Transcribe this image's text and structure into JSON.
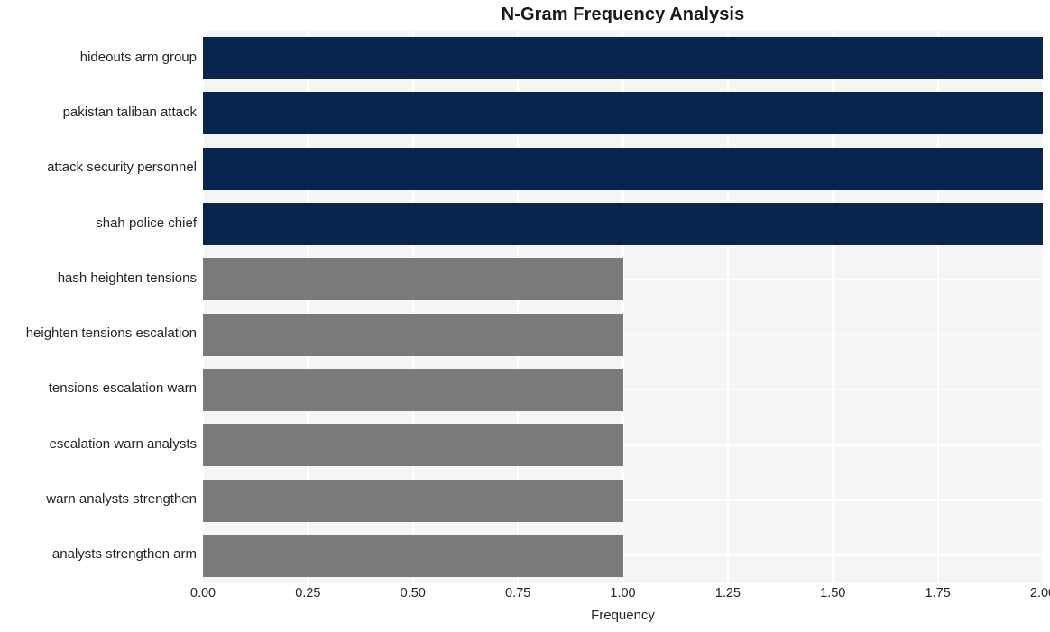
{
  "chart_data": {
    "type": "bar",
    "orientation": "horizontal",
    "title": "N-Gram Frequency Analysis",
    "xlabel": "Frequency",
    "ylabel": "",
    "categories": [
      "hideouts arm group",
      "pakistan taliban attack",
      "attack security personnel",
      "shah police chief",
      "hash heighten tensions",
      "heighten tensions escalation",
      "tensions escalation warn",
      "escalation warn analysts",
      "warn analysts strengthen",
      "analysts strengthen arm"
    ],
    "values": [
      2,
      2,
      2,
      2,
      1,
      1,
      1,
      1,
      1,
      1
    ],
    "bar_colors": [
      "#07254f",
      "#07254f",
      "#07254f",
      "#07254f",
      "#7b7a78",
      "#7b7a78",
      "#7b7a78",
      "#7b7a78",
      "#7b7a78",
      "#7b7a78"
    ],
    "xlim": [
      0.0,
      2.0
    ],
    "xticks": [
      0.0,
      0.25,
      0.5,
      0.75,
      1.0,
      1.25,
      1.5,
      1.75,
      2.0
    ],
    "xticklabels": [
      "0.00",
      "0.25",
      "0.50",
      "0.75",
      "1.00",
      "1.25",
      "1.50",
      "1.75",
      "2.00"
    ],
    "grid": true,
    "grid_color": "#ffffff",
    "plot_background": "#f5f5f5",
    "figure_background": "#ffffff",
    "legend": null
  }
}
